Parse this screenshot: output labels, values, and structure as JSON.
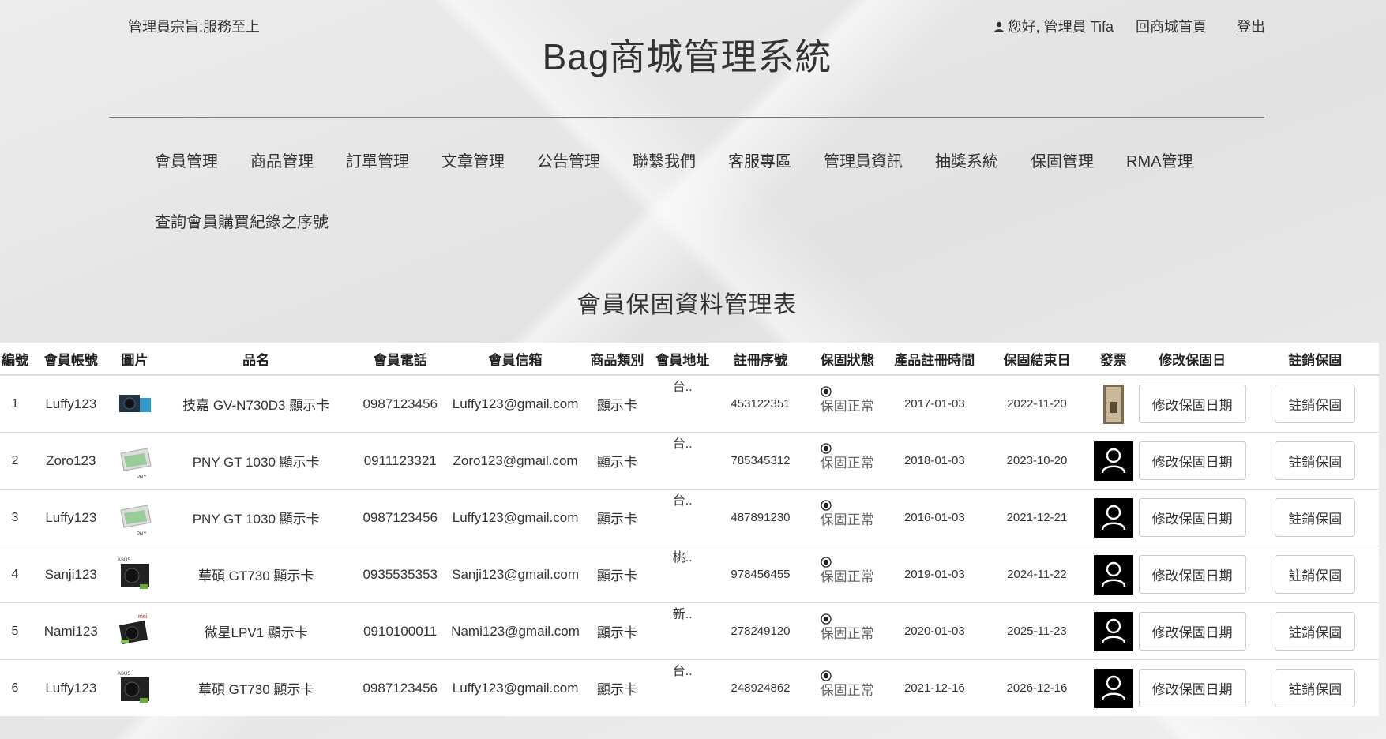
{
  "header": {
    "motto": "管理員宗旨:服務至上",
    "title": "Bag商城管理系統",
    "greeting": "您好, 管理員 Tifa",
    "home_link": "回商城首頁",
    "logout": "登出"
  },
  "nav": {
    "row1": [
      "會員管理",
      "商品管理",
      "訂單管理",
      "文章管理",
      "公告管理",
      "聯繫我們",
      "客服專區",
      "管理員資訊",
      "抽獎系統",
      "保固管理",
      "RMA管理"
    ],
    "row2": [
      "查詢會員購買紀錄之序號"
    ]
  },
  "table": {
    "title": "會員保固資料管理表",
    "headers": [
      "編號",
      "會員帳號",
      "圖片",
      "品名",
      "會員電話",
      "會員信箱",
      "商品類別",
      "會員地址",
      "註冊序號",
      "保固狀態",
      "產品註冊時間",
      "保固結束日",
      "發票",
      "修改保固日",
      "註銷保固"
    ],
    "modify_label": "修改保固日期",
    "cancel_label": "註銷保固",
    "rows": [
      {
        "id": "1",
        "account": "Luffy123",
        "product": "技嘉 GV-N730D3 顯示卡",
        "phone": "0987123456",
        "email": "Luffy123@gmail.com",
        "category": "顯示卡",
        "address": "台..",
        "serial": "453122351",
        "status": "保固正常",
        "reg_date": "2017-01-03",
        "end_date": "2022-11-20",
        "img": "gigabyte-card-icon",
        "invoice": "receipt-photo"
      },
      {
        "id": "2",
        "account": "Zoro123",
        "product": "PNY GT 1030 顯示卡",
        "phone": "0911123321",
        "email": "Zoro123@gmail.com",
        "category": "顯示卡",
        "address": "台..",
        "serial": "785345312",
        "status": "保固正常",
        "reg_date": "2018-01-03",
        "end_date": "2023-10-20",
        "img": "pny-card-icon",
        "invoice": "user-avatar-icon"
      },
      {
        "id": "3",
        "account": "Luffy123",
        "product": "PNY GT 1030 顯示卡",
        "phone": "0987123456",
        "email": "Luffy123@gmail.com",
        "category": "顯示卡",
        "address": "台..",
        "serial": "487891230",
        "status": "保固正常",
        "reg_date": "2016-01-03",
        "end_date": "2021-12-21",
        "img": "pny-card-icon",
        "invoice": "user-avatar-icon"
      },
      {
        "id": "4",
        "account": "Sanji123",
        "product": "華碩 GT730 顯示卡",
        "phone": "0935535353",
        "email": "Sanji123@gmail.com",
        "category": "顯示卡",
        "address": "桃..",
        "serial": "978456455",
        "status": "保固正常",
        "reg_date": "2019-01-03",
        "end_date": "2024-11-22",
        "img": "asus-card-icon",
        "invoice": "user-avatar-icon"
      },
      {
        "id": "5",
        "account": "Nami123",
        "product": "微星LPV1 顯示卡",
        "phone": "0910100011",
        "email": "Nami123@gmail.com",
        "category": "顯示卡",
        "address": "新..",
        "serial": "278249120",
        "status": "保固正常",
        "reg_date": "2020-01-03",
        "end_date": "2025-11-23",
        "img": "msi-card-icon",
        "invoice": "user-avatar-icon"
      },
      {
        "id": "6",
        "account": "Luffy123",
        "product": "華碩 GT730 顯示卡",
        "phone": "0987123456",
        "email": "Luffy123@gmail.com",
        "category": "顯示卡",
        "address": "台..",
        "serial": "248924862",
        "status": "保固正常",
        "reg_date": "2021-12-16",
        "end_date": "2026-12-16",
        "img": "asus-card-icon",
        "invoice": "user-avatar-icon"
      }
    ]
  }
}
